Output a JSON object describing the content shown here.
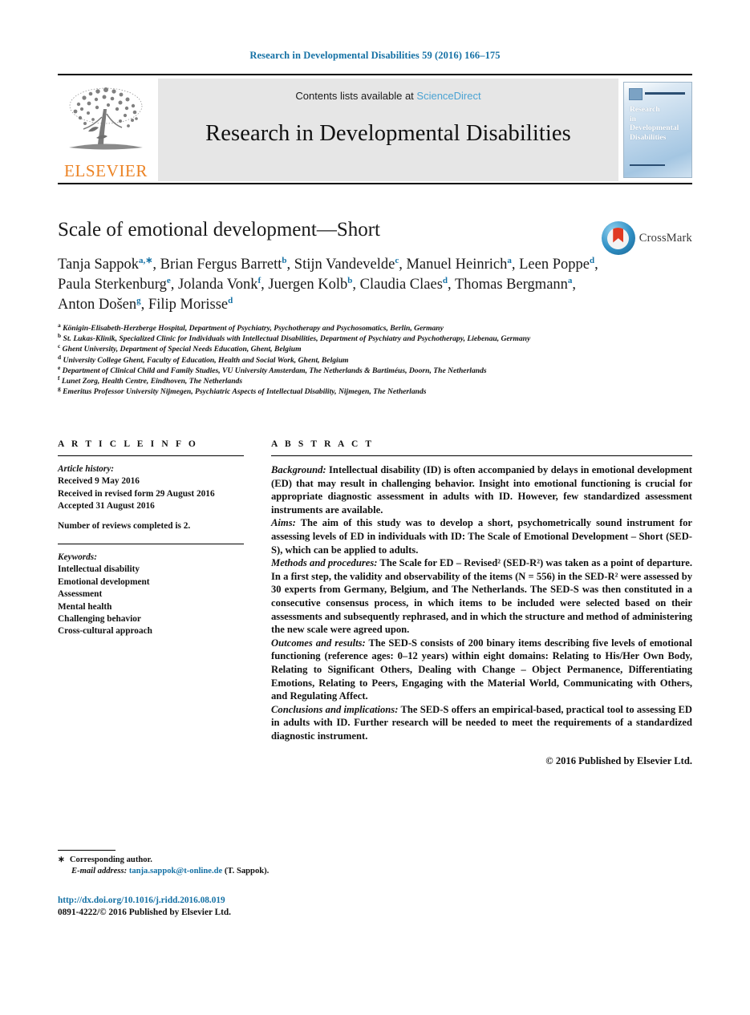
{
  "running_head": "Research in Developmental Disabilities 59 (2016) 166–175",
  "masthead": {
    "publisher_name": "ELSEVIER",
    "contents_prefix": "Contents lists available at ",
    "contents_link": "ScienceDirect",
    "journal_title": "Research in Developmental Disabilities",
    "cover_text": "Research\nin\nDevelopmental\nDisabilities"
  },
  "article": {
    "title": "Scale of emotional development—Short",
    "crossmark_label": "CrossMark",
    "authors_html": "Tanja Sappok<sup>a,∗</sup>, Brian Fergus Barrett<sup>b</sup>, Stijn Vandevelde<sup>c</sup>, Manuel Heinrich<sup>a</sup>, Leen Poppe<sup>d</sup>, Paula Sterkenburg<sup>e</sup>, Jolanda Vonk<sup>f</sup>, Juergen Kolb<sup>b</sup>, Claudia Claes<sup>d</sup>, Thomas Bergmann<sup>a</sup>, Anton Došen<sup>g</sup>, Filip Morisse<sup>d</sup>",
    "affiliations": [
      {
        "marker": "a",
        "text": "Königin-Elisabeth-Herzberge Hospital, Department of Psychiatry, Psychotherapy and Psychosomatics, Berlin, Germany"
      },
      {
        "marker": "b",
        "text": "St. Lukas-Klinik, Specialized Clinic for Individuals with Intellectual Disabilities, Department of Psychiatry and Psychotherapy, Liebenau, Germany"
      },
      {
        "marker": "c",
        "text": "Ghent University, Department of Special Needs Education, Ghent, Belgium"
      },
      {
        "marker": "d",
        "text": "University College Ghent, Faculty of Education, Health and Social Work, Ghent, Belgium"
      },
      {
        "marker": "e",
        "text": "Department of Clinical Child and Family Studies, VU University Amsterdam, The Netherlands & Bartiméus, Doorn, The Netherlands"
      },
      {
        "marker": "f",
        "text": "Lunet Zorg, Health Centre, Eindhoven, The Netherlands"
      },
      {
        "marker": "g",
        "text": "Emeritus Professor University Nijmegen, Psychiatric Aspects of Intellectual Disability, Nijmegen, The Netherlands"
      }
    ]
  },
  "article_info": {
    "heading": "A R T I C L E   I N F O",
    "history_label": "Article history:",
    "history": [
      "Received 9 May 2016",
      "Received in revised form 29 August 2016",
      "Accepted 31 August 2016"
    ],
    "reviews_note": "Number of reviews completed is 2.",
    "keywords_label": "Keywords:",
    "keywords": [
      "Intellectual disability",
      "Emotional development",
      "Assessment",
      "Mental health",
      "Challenging behavior",
      "Cross-cultural approach"
    ]
  },
  "abstract": {
    "heading": "A B S T R A C T",
    "sections": [
      {
        "lead": "Background:",
        "text": " Intellectual disability (ID) is often accompanied by delays in emotional development (ED) that may result in challenging behavior. Insight into emotional functioning is crucial for appropriate diagnostic assessment in adults with ID. However, few standardized assessment instruments are available."
      },
      {
        "lead": "Aims:",
        "text": " The aim of this study was to develop a short, psychometrically sound instrument for assessing levels of ED in individuals with ID: The Scale of Emotional Development – Short (SED-S), which can be applied to adults."
      },
      {
        "lead": "Methods and procedures:",
        "text": " The Scale for ED – Revised² (SED-R²) was taken as a point of departure. In a first step, the validity and observability of the items (N = 556) in the SED-R² were assessed by 30 experts from Germany, Belgium, and The Netherlands. The SED-S was then constituted in a consecutive consensus process, in which items to be included were selected based on their assessments and subsequently rephrased, and in which the structure and method of administering the new scale were agreed upon."
      },
      {
        "lead": "Outcomes and results:",
        "text": " The SED-S consists of 200 binary items describing five levels of emotional functioning (reference ages: 0–12 years) within eight domains: Relating to His/Her Own Body, Relating to Significant Others, Dealing with Change – Object Permanence, Differentiating Emotions, Relating to Peers, Engaging with the Material World, Communicating with Others, and Regulating Affect."
      },
      {
        "lead": "Conclusions and implications:",
        "text": " The SED-S offers an empirical-based, practical tool to assessing ED in adults with ID. Further research will be needed to meet the requirements of a standardized diagnostic instrument."
      }
    ],
    "copyright": "© 2016 Published by Elsevier Ltd."
  },
  "footer": {
    "corresponding_star": "∗",
    "corresponding_label": "Corresponding author.",
    "email_label": "E-mail address:",
    "email": "tanja.sappok@t-online.de",
    "email_suffix": " (T. Sappok).",
    "doi": "http://dx.doi.org/10.1016/j.ridd.2016.08.019",
    "issn_line": "0891-4222/© 2016 Published by Elsevier Ltd."
  },
  "colors": {
    "link": "#1571a5",
    "sciencedirect": "#4ba3d3",
    "elsevier_orange": "#ec8324",
    "band_gray": "#e6e6e6"
  }
}
